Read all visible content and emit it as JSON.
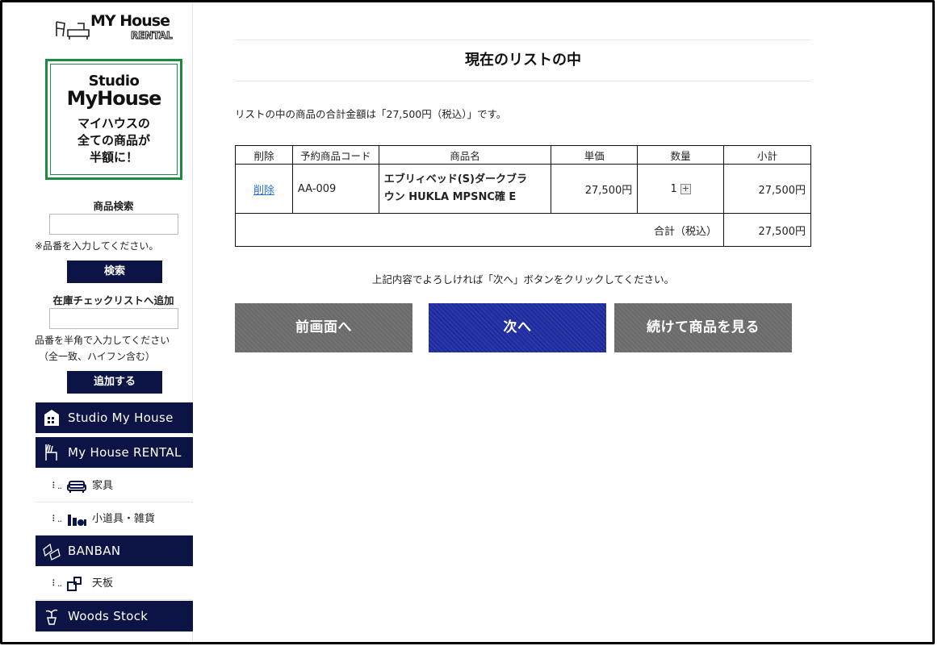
{
  "sidebar": {
    "logo": {
      "title": "MY House",
      "sub": "RENTAL"
    },
    "banner": {
      "line1": "Studio",
      "line2": "MyHouse",
      "line3": "マイハウスの",
      "line4": "全ての商品が",
      "line5": "半額に！"
    },
    "search": {
      "label": "商品検索",
      "placeholder": "",
      "note": "※品番を入力してください。",
      "button": "検索"
    },
    "stock_check": {
      "label": "在庫チェックリストへ追加",
      "note1": "品番を半角で入力してください",
      "note2": "（全一致、ハイフン含む）",
      "button": "追加する"
    },
    "categories": [
      {
        "label": "Studio My House",
        "icon": "building-icon"
      },
      {
        "label": "My House RENTAL",
        "icon": "chair-icon"
      },
      {
        "label": "家具",
        "icon": "sofa-icon"
      },
      {
        "label": "小道具・雑貨",
        "icon": "props-icon"
      },
      {
        "label": "BANBAN",
        "icon": "banban-logo-icon"
      },
      {
        "label": "天板",
        "icon": "tabletop-icon"
      },
      {
        "label": "Woods Stock",
        "icon": "plant-icon"
      }
    ]
  },
  "main": {
    "title": "現在のリストの中",
    "summary": "リストの中の商品の合計金額は「27,500円（税込）」です。",
    "table": {
      "headers": [
        "削除",
        "予約商品コード",
        "商品名",
        "単価",
        "数量",
        "小計"
      ],
      "rows": [
        {
          "delete": "削除",
          "code": "AA-009",
          "name_line1": "エブリィベッド(S)ダークブラ",
          "name_line2": "ウン HUKLA MPSNC確 E",
          "unit_price": "27,500円",
          "qty": "1",
          "subtotal": "27,500円"
        }
      ],
      "total_label": "合計（税込）",
      "total_value": "27,500円"
    },
    "confirm_text": "上記内容でよろしければ「次へ」ボタンをクリックしてください。",
    "buttons": {
      "back": "前画面へ",
      "next": "次へ",
      "continue": "続けて商品を見る"
    }
  }
}
